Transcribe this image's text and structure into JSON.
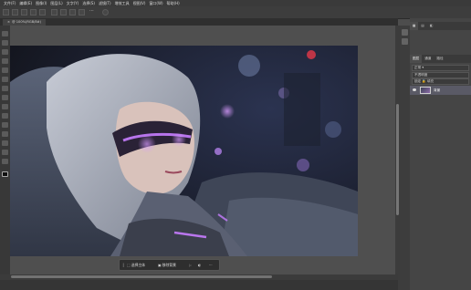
{
  "menubar": {
    "items": [
      "文件(F)",
      "编辑(E)",
      "图像(I)",
      "图层(L)",
      "文字(Y)",
      "选择(S)",
      "滤镜(T)",
      "增效工具",
      "视图(V)",
      "窗口(W)",
      "帮助(H)"
    ]
  },
  "document": {
    "tab_label": "@ 100%(RGB/8#)"
  },
  "context_bar": {
    "select_subject_label": "选择主体",
    "remove_background_label": "移除背景",
    "more_label": "···"
  },
  "layers_panel": {
    "tabs": [
      "图层",
      "通道",
      "路径"
    ],
    "mode_label": "正常",
    "opacity_label": "不透明度",
    "lock_label": "锁定",
    "fill_label": "填充",
    "layer_name": "背景"
  },
  "colors": {
    "ui_dark": "#3a3a3a",
    "canvas_bg": "#4f4f4f",
    "accent_purple": "#b36cff"
  }
}
